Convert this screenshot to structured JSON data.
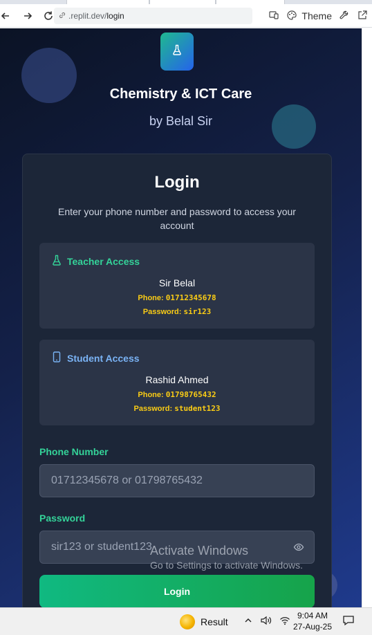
{
  "browser": {
    "url_domain": ".replit.dev/",
    "url_path": "login",
    "theme_label": "Theme"
  },
  "app": {
    "title": "Chemistry & ICT Care",
    "subtitle": "by Belal Sir"
  },
  "login": {
    "title": "Login",
    "description": "Enter your phone number and password to access your account",
    "teacher": {
      "heading": "Teacher Access",
      "name": "Sir Belal",
      "phone_label": "Phone:",
      "phone": "01712345678",
      "password_label": "Password:",
      "password": "sir123"
    },
    "student": {
      "heading": "Student Access",
      "name": "Rashid Ahmed",
      "phone_label": "Phone:",
      "phone": "01798765432",
      "password_label": "Password:",
      "password": "student123"
    },
    "phone_field_label": "Phone Number",
    "phone_placeholder": "01712345678 or 01798765432",
    "password_field_label": "Password",
    "password_placeholder": "sir123 or student123",
    "submit_label": "Login"
  },
  "watermark": {
    "line1": "Activate Windows",
    "line2": "Go to Settings to activate Windows."
  },
  "taskbar": {
    "app_label": "Result",
    "time": "9:04 AM",
    "date": "27-Aug-25"
  },
  "colors": {
    "accent_green": "#34d399",
    "accent_blue": "#7ab3f5",
    "credential_yellow": "#facc15",
    "button_green": "#10b981"
  }
}
